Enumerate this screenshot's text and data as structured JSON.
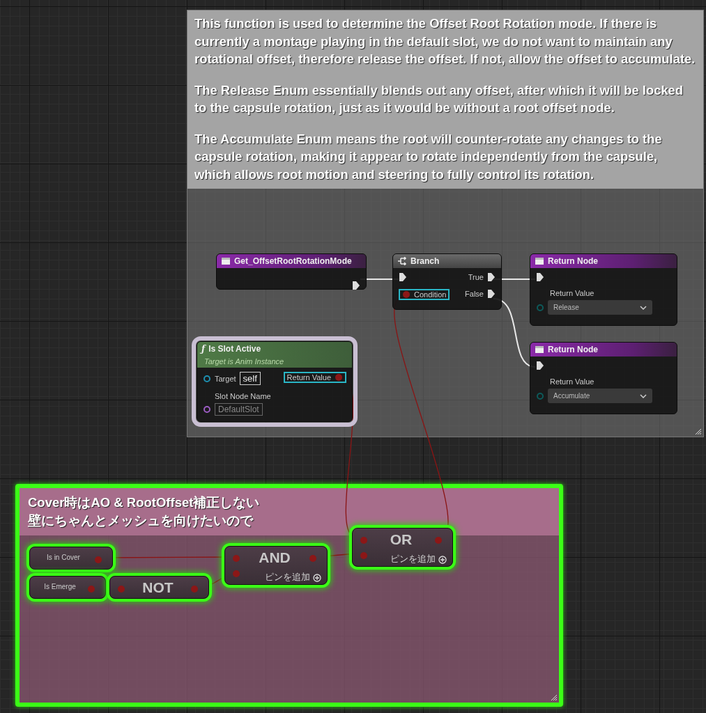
{
  "comments": [
    {
      "kind": "note",
      "lines": [
        "This function is used to determine the Offset Root Rotation mode. If there is currently a montage playing in the default slot, we do not want to maintain any rotational offset, therefore release the offset. If not, allow the offset to accumulate.",
        "The Release Enum essentially blends out any offset, after which it will be locked to the capsule rotation, just as it would be without a root offset node.",
        "The Accumulate Enum means the root will counter-rotate any changes to the capsule rotation, making it appear to rotate independently from the capsule, which allows root motion and steering to fully control its rotation."
      ],
      "selected": false
    },
    {
      "kind": "group",
      "lines": [
        "Cover時はAO & RootOffset補正しない",
        "壁にちゃんとメッシュを向けたいので"
      ],
      "selected": true
    }
  ],
  "nodes": [
    {
      "kind": "entry",
      "title": "Get_OffsetRootRotationMode",
      "selected": false,
      "highlighted": false,
      "outputs": [
        {
          "kind": "exec"
        }
      ]
    },
    {
      "kind": "branch",
      "title": "Branch",
      "selected": false,
      "highlighted": false,
      "inputs": [
        {
          "kind": "exec"
        },
        {
          "kind": "bool",
          "label": "Condition",
          "highlighted": true
        }
      ],
      "outputs": [
        {
          "kind": "exec",
          "label": "True"
        },
        {
          "kind": "exec",
          "label": "False"
        }
      ]
    },
    {
      "kind": "return",
      "title": "Return Node",
      "selected": false,
      "highlighted": false,
      "inputs": [
        {
          "kind": "exec"
        },
        {
          "kind": "enum",
          "label": "Return Value",
          "value": "Release"
        }
      ]
    },
    {
      "kind": "function",
      "icon": "ƒ",
      "title": "Is Slot Active",
      "subtitle": "Target is Anim Instance",
      "selected": false,
      "highlighted": true,
      "inputs": [
        {
          "kind": "object",
          "label": "Target",
          "value": "self"
        },
        {
          "kind": "name",
          "label": "Slot Node Name",
          "value": "DefaultSlot"
        }
      ],
      "outputs": [
        {
          "kind": "bool",
          "label": "Return Value",
          "highlighted": true
        }
      ]
    },
    {
      "kind": "return",
      "title": "Return Node",
      "selected": false,
      "highlighted": false,
      "inputs": [
        {
          "kind": "exec"
        },
        {
          "kind": "enum",
          "label": "Return Value",
          "value": "Accumulate"
        }
      ]
    },
    {
      "kind": "variable",
      "title": "Is in Cover",
      "selected": true,
      "highlighted": false,
      "outputs": [
        {
          "kind": "bool"
        }
      ]
    },
    {
      "kind": "variable",
      "title": "Is Emerge",
      "selected": true,
      "highlighted": false,
      "outputs": [
        {
          "kind": "bool"
        }
      ]
    },
    {
      "kind": "operator",
      "title": "NOT",
      "selected": true,
      "highlighted": false,
      "inputs": [
        {
          "kind": "bool"
        }
      ],
      "outputs": [
        {
          "kind": "bool"
        }
      ]
    },
    {
      "kind": "operator",
      "title": "AND",
      "add_pin": "ピンを追加",
      "selected": true,
      "highlighted": false,
      "inputs": [
        {
          "kind": "bool"
        },
        {
          "kind": "bool"
        }
      ],
      "outputs": [
        {
          "kind": "bool"
        }
      ]
    },
    {
      "kind": "operator",
      "title": "OR",
      "add_pin": "ピンを追加",
      "selected": true,
      "highlighted": false,
      "inputs": [
        {
          "kind": "bool"
        },
        {
          "kind": "bool"
        }
      ],
      "outputs": [
        {
          "kind": "bool"
        }
      ]
    }
  ],
  "wires": [
    {
      "kind": "exec"
    },
    {
      "kind": "exec"
    },
    {
      "kind": "exec"
    },
    {
      "kind": "bool"
    },
    {
      "kind": "bool"
    },
    {
      "kind": "bool"
    },
    {
      "kind": "bool"
    },
    {
      "kind": "bool"
    },
    {
      "kind": "bool"
    }
  ]
}
